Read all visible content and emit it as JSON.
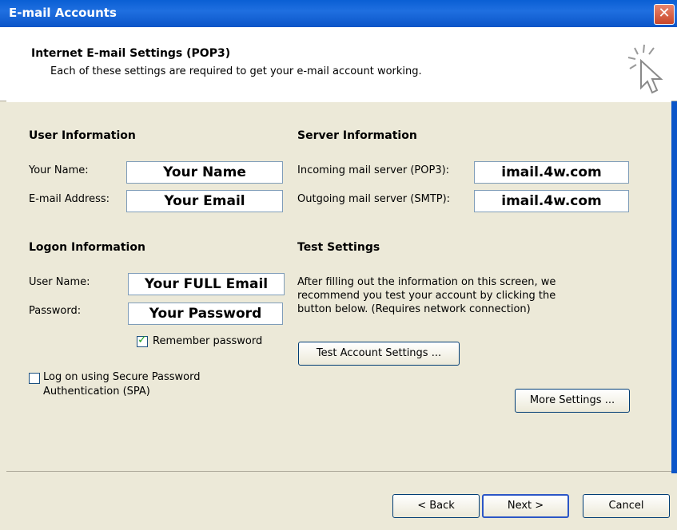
{
  "window": {
    "title": "E-mail Accounts",
    "close_glyph": "✕"
  },
  "header": {
    "title": "Internet E-mail Settings (POP3)",
    "subtitle": "Each of these settings are required to get your e-mail account working.",
    "icon": "wizard-cursor-icon"
  },
  "user_info": {
    "heading": "User Information",
    "name_label": "Your Name:",
    "name_value": "Your Name",
    "email_label": "E-mail Address:",
    "email_value": "Your Email"
  },
  "server_info": {
    "heading": "Server Information",
    "incoming_label": "Incoming mail server (POP3):",
    "incoming_value": "imail.4w.com",
    "outgoing_label": "Outgoing mail server (SMTP):",
    "outgoing_value": "imail.4w.com"
  },
  "logon_info": {
    "heading": "Logon Information",
    "username_label": "User Name:",
    "username_value": "Your FULL Email",
    "password_label": "Password:",
    "password_value": "Your Password",
    "remember_label": "Remember password",
    "remember_checked": true,
    "spa_label_line1": "Log on using Secure Password",
    "spa_label_line2": "Authentication (SPA)",
    "spa_checked": false
  },
  "test_settings": {
    "heading": "Test Settings",
    "description": "After filling out the information on this screen, we recommend you test your account by clicking the button below. (Requires network connection)",
    "test_button": "Test Account Settings ..."
  },
  "more_settings_button": "More Settings ...",
  "footer": {
    "back": "< Back",
    "next": "Next >",
    "cancel": "Cancel"
  },
  "colors": {
    "titlebar": "#0b55c8",
    "dialog_bg": "#ece9d8",
    "check": "#21a121",
    "close": "#c8462a"
  }
}
